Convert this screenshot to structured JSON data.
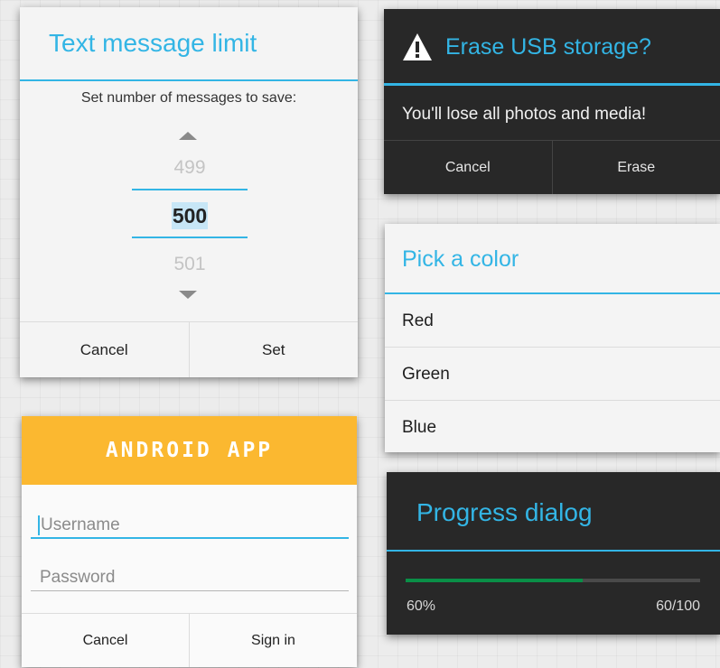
{
  "number_picker_dialog": {
    "title": "Text message limit",
    "prompt": "Set number of messages to save:",
    "previous_value": "499",
    "current_value": "500",
    "next_value": "501",
    "cancel_label": "Cancel",
    "set_label": "Set"
  },
  "erase_dialog": {
    "icon": "warning-icon",
    "title": "Erase USB storage?",
    "message": "You'll lose all photos and media!",
    "cancel_label": "Cancel",
    "erase_label": "Erase"
  },
  "color_dialog": {
    "title": "Pick a color",
    "options": [
      "Red",
      "Green",
      "Blue"
    ]
  },
  "login_dialog": {
    "brand": "ANDROID APP",
    "username_placeholder": "Username",
    "password_placeholder": "Password",
    "cancel_label": "Cancel",
    "signin_label": "Sign in"
  },
  "progress_dialog": {
    "title": "Progress dialog",
    "percent_text": "60%",
    "count_text": "60/100",
    "progress_fraction": 0.6
  },
  "colors": {
    "accent": "#33b5e5",
    "login_header": "#fbb830",
    "progress_fill": "#0a8f47"
  }
}
